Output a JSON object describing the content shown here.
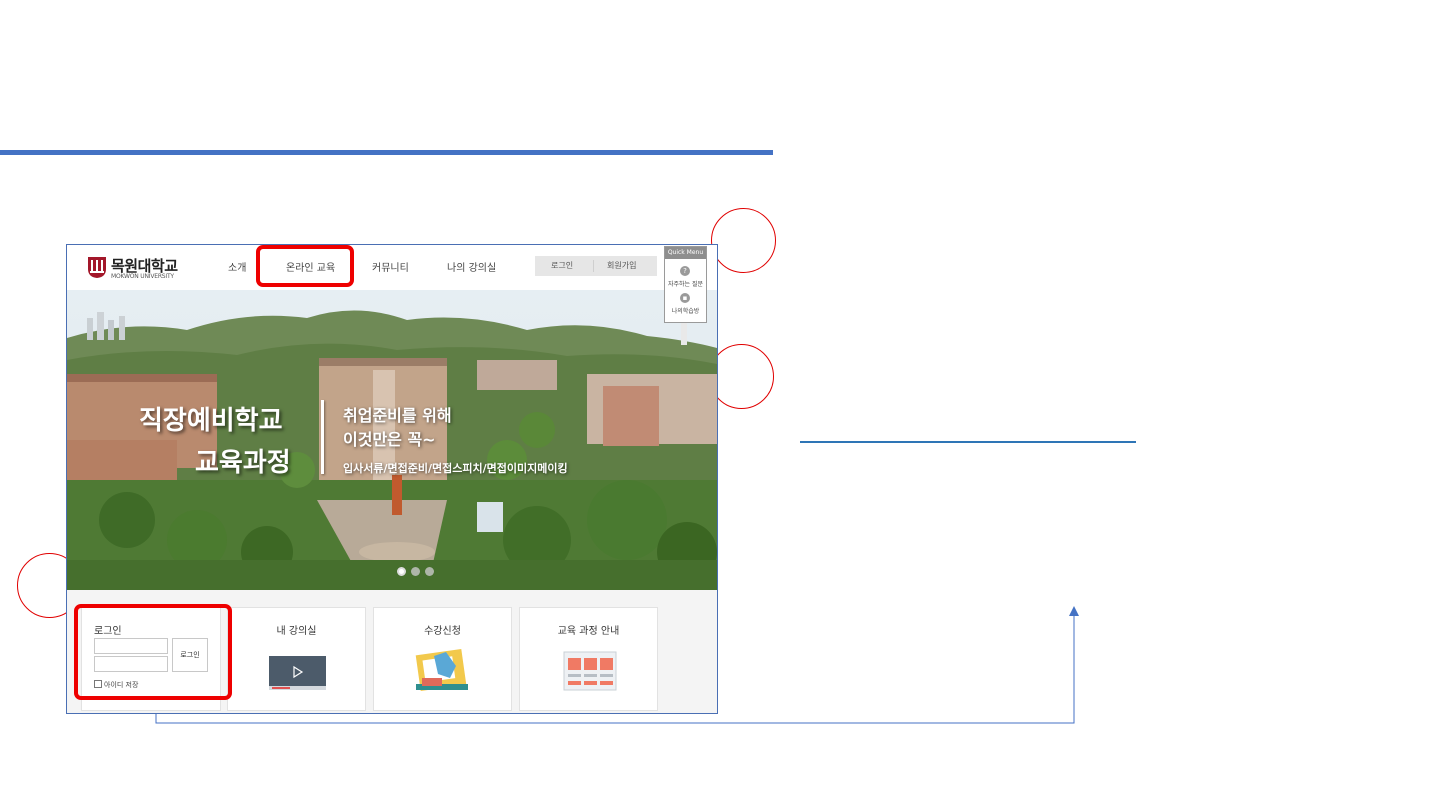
{
  "logo": {
    "name_ko": "목원대학교",
    "name_en": "MOKWON UNIVERSITY"
  },
  "nav": {
    "items": [
      {
        "label": "소개"
      },
      {
        "label": "온라인 교육"
      },
      {
        "label": "커뮤니티"
      },
      {
        "label": "나의 강의실"
      }
    ]
  },
  "auth": {
    "login_label": "로그인",
    "signup_label": "회원가입"
  },
  "quick_menu": {
    "title": "Quick Menu",
    "items": [
      {
        "label": "자주하는 질문",
        "icon": "question-icon"
      },
      {
        "label": "나의학습방",
        "icon": "chat-icon"
      }
    ]
  },
  "hero": {
    "title_line1": "직장예비학교",
    "title_line2": "교육과정",
    "sub_line1": "취업준비를 위해",
    "sub_line2": "이것만은 꼭~",
    "sub_line3": "입사서류/면접준비/면접스피치/면접이미지메이킹",
    "slide_count": 3,
    "active_slide": 1
  },
  "login_card": {
    "title": "로그인",
    "id_value": "",
    "password_value": "",
    "submit_label": "로그인",
    "save_id_label": "아이디 저장",
    "save_id_checked": false
  },
  "cards": [
    {
      "title": "내 강의실",
      "icon": "video-player-icon"
    },
    {
      "title": "수강신청",
      "icon": "hand-document-icon"
    },
    {
      "title": "교육 과정 안내",
      "icon": "course-grid-icon"
    }
  ],
  "colors": {
    "highlight": "#ee0000",
    "callout": "#e00000",
    "rule": "#4472c4",
    "connector": "#4472c4"
  }
}
